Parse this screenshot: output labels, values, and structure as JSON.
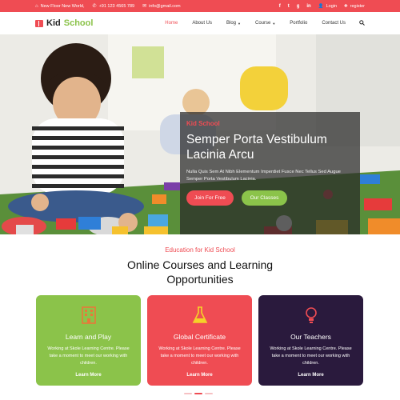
{
  "topbar": {
    "address": "New Floor New World,",
    "phone": "+91 123 4565 789",
    "email": "info@gmail.com",
    "social": [
      "f",
      "t",
      "g",
      "in"
    ],
    "login": "Login",
    "register": "register"
  },
  "logo": {
    "word1": "Kid",
    "word2": "School"
  },
  "nav": {
    "items": [
      {
        "label": "Home",
        "active": true
      },
      {
        "label": "About Us"
      },
      {
        "label": "Blog",
        "dropdown": true
      },
      {
        "label": "Course",
        "dropdown": true
      },
      {
        "label": "Portfolio"
      },
      {
        "label": "Contact Us"
      }
    ],
    "search_icon": "search-icon"
  },
  "hero": {
    "eyebrow": "Kid School",
    "title": "Semper Porta Vestibulum Lacinia Arcu",
    "text": "Nulla Quis Sem At Nibh Elementum Imperdiet Fusce Nec Tellus Sed Augue Semper Porta Vestibulum Lacinia.",
    "btn_primary": "Join For Free",
    "btn_secondary": "Our Classes"
  },
  "section": {
    "eyebrow": "Education for Kid School",
    "title_line1": "Online Courses and Learning",
    "title_line2": "Opportunities"
  },
  "cards": [
    {
      "icon": "building-icon",
      "title": "Learn and Play",
      "text": "Working at Skole Learning Centre. Please take a moment to meet our working with children.",
      "more": "Learn More",
      "color": "#8bc34a"
    },
    {
      "icon": "flask-icon",
      "title": "Global Certificate",
      "text": "Working at Skole Learning Centre. Please take a moment to meet our working with children.",
      "more": "Learn More",
      "color": "#ef4c53"
    },
    {
      "icon": "lightbulb-icon",
      "title": "Our Teachers",
      "text": "Working at Skole Learning Centre. Please take a moment to meet our working with children.",
      "more": "Learn More",
      "color": "#2a1a3d"
    }
  ],
  "colors": {
    "accent": "#ef4c53",
    "green": "#8bc34a",
    "dark": "#2a1a3d"
  }
}
